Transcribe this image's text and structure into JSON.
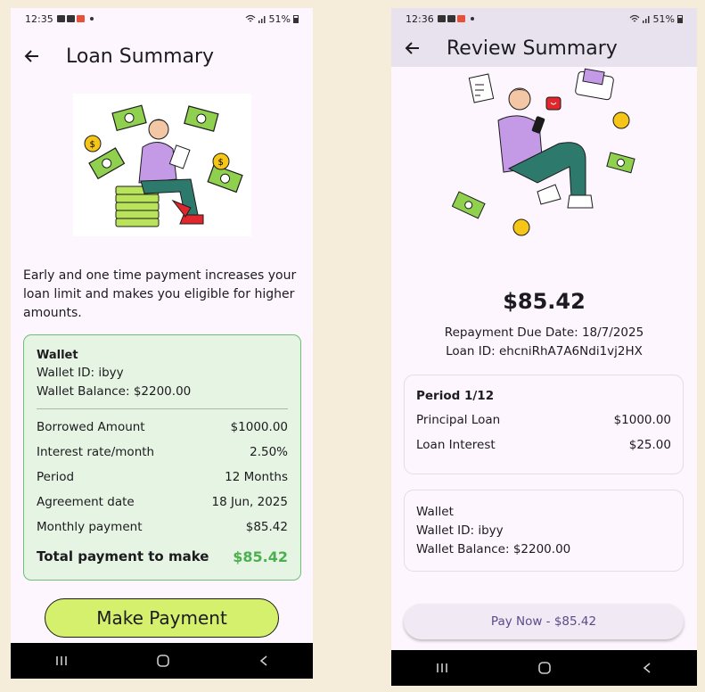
{
  "phone1": {
    "status": {
      "time": "12:35",
      "battery": "51%"
    },
    "appbar": {
      "title": "Loan Summary"
    },
    "description": "Early and one time payment increases your loan limit and makes you eligible for higher amounts.",
    "wallet": {
      "heading": "Wallet",
      "id_line": "Wallet ID: ibyy",
      "balance_line": "Wallet Balance: $2200.00"
    },
    "details": [
      {
        "label": "Borrowed Amount",
        "value": "$1000.00"
      },
      {
        "label": "Interest rate/month",
        "value": "2.50%"
      },
      {
        "label": "Period",
        "value": "12 Months"
      },
      {
        "label": "Agreement date",
        "value": "18 Jun, 2025"
      },
      {
        "label": "Monthly payment",
        "value": "$85.42"
      }
    ],
    "total": {
      "label": "Total payment to make",
      "value": "$85.42"
    },
    "button": "Make Payment"
  },
  "phone2": {
    "status": {
      "time": "12:36",
      "battery": "51%"
    },
    "appbar": {
      "title": "Review Summary"
    },
    "amount": "$85.42",
    "due_date": "Repayment Due Date: 18/7/2025",
    "loan_id": "Loan ID: ehcniRhA7A6Ndi1vj2HX",
    "period_card": {
      "heading": "Period 1/12",
      "rows": [
        {
          "label": "Principal Loan",
          "value": "$1000.00"
        },
        {
          "label": "Loan Interest",
          "value": "$25.00"
        }
      ]
    },
    "wallet_card": {
      "heading": "Wallet",
      "id_line": "Wallet ID: ibyy",
      "balance_line": "Wallet Balance: $2200.00"
    },
    "button": "Pay Now - $85.42"
  },
  "colors": {
    "background": "#f5ecd9",
    "screen": "#fdf6fe",
    "card_green": "#e6f4e3",
    "card_border": "#6cbf74",
    "total_green": "#4caf50",
    "make_payment_btn": "#d5f06c",
    "pay_now_text": "#5b4a8b",
    "appbar2": "#e8e2ee"
  },
  "icons": [
    "back-arrow-icon",
    "wifi-icon",
    "signal-icon",
    "battery-icon",
    "nav-recents-icon",
    "nav-home-icon",
    "nav-back-icon"
  ]
}
